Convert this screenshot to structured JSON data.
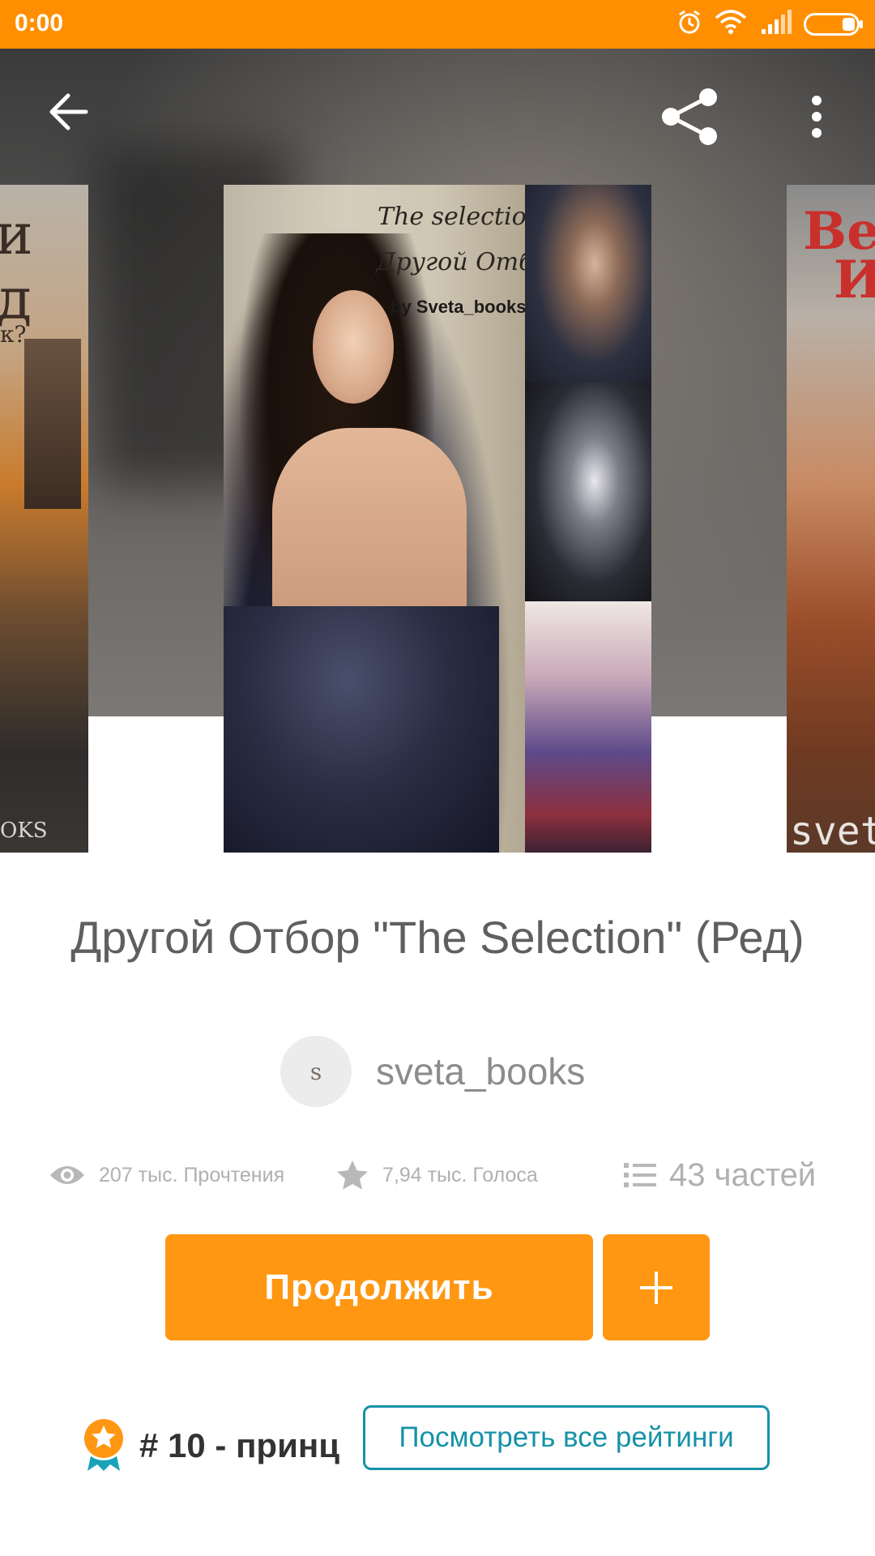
{
  "status_bar": {
    "time": "0:00"
  },
  "hero": {
    "left_cover": {
      "line1": "и",
      "line2": "д",
      "line3": "к?",
      "footer": "OKS"
    },
    "main_cover": {
      "line1": "The selection",
      "line2": "Другой Отбор",
      "line3": "by Sveta_books"
    },
    "right_cover": {
      "line1": "Ве",
      "line2": "И",
      "footer": "sveta"
    }
  },
  "story": {
    "title": "Другой Отбор \"The Selection\" (Ред)",
    "author_initial": "s",
    "author": "sveta_books",
    "reads": "207 тыс. Прочтения",
    "votes": "7,94 тыс. Голоса",
    "parts": "43 частей"
  },
  "actions": {
    "continue_label": "Продолжить",
    "add_label": "+"
  },
  "ranking": {
    "rank_text": "# 10 - принц",
    "view_all_label": "Посмотреть все рейтинги"
  },
  "colors": {
    "accent": "#ff9712",
    "status_bar": "#ff8f00",
    "link": "#1592a8"
  }
}
